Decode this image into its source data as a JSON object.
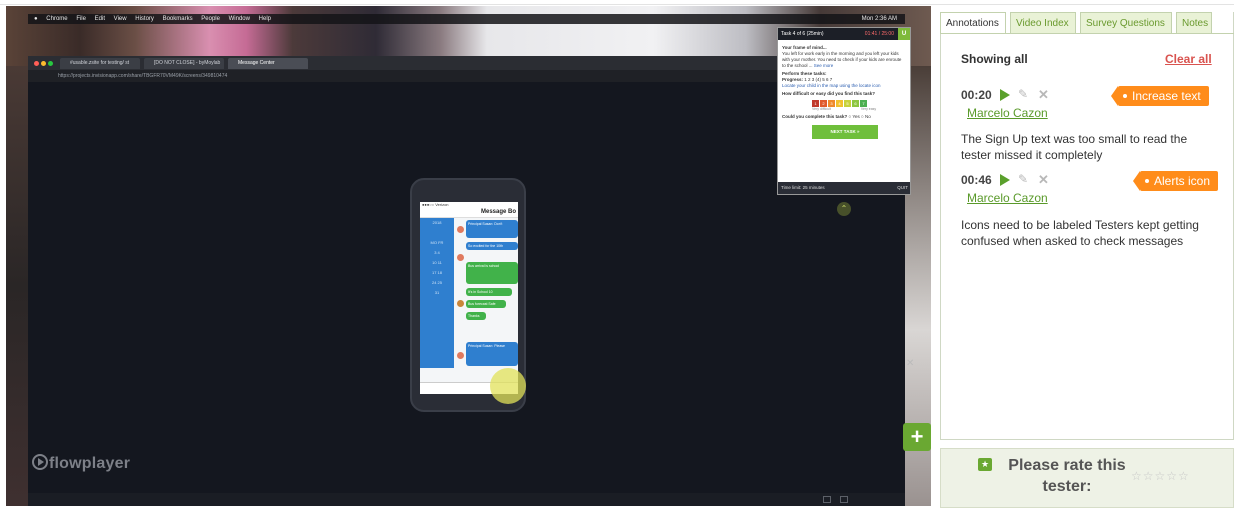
{
  "recording": {
    "menubar": {
      "items": [
        "Chrome",
        "File",
        "Edit",
        "View",
        "History",
        "Bookmarks",
        "People",
        "Window",
        "Help"
      ],
      "clock": "Mon 2:36 AM"
    },
    "browser_tabs": [
      {
        "label": "#usable.zsite for testing/ st"
      },
      {
        "label": "[DO NOT CLOSE] - byMoylab"
      },
      {
        "label": "Message Center"
      }
    ],
    "address": "https://projects.invisionapp.com/share/TBGFR70VM49K/screens/349810474",
    "phone": {
      "status": "●●●○○ Verizon",
      "title": "Message Bo",
      "calendar_rows": [
        "2018",
        "",
        "MO  FR",
        "3  4",
        "10  11",
        "17  18",
        "24  25",
        "31"
      ],
      "bubbles": [
        {
          "text": "Principal Susan: Don't",
          "color": "blue"
        },
        {
          "text": "So excited for the 10th",
          "color": "blue"
        },
        {
          "text": "Bus arrival is school",
          "color": "green"
        },
        {
          "text": "It's in School 10",
          "color": "green"
        },
        {
          "text": "Bus forecast Safe",
          "color": "green"
        },
        {
          "text": "Thanks",
          "color": "green"
        },
        {
          "text": "Principal Susan: Please",
          "color": "blue"
        }
      ]
    },
    "task": {
      "header": "Task 4 of 6 (25min)",
      "timer": "01:41 / 25:00",
      "frame_title": "Your frame of mind...",
      "frame_text": "You left for work early in the morning and you left your kids with your mother. You need to check if your kids are enroute to the school ...",
      "see_more": "See more",
      "perform_label": "Perform these tasks:",
      "progress_label": "Progress:",
      "progress_steps": "1 2 3 (4) 5 6 7",
      "task_instruction": "Locate your child in the map using the locate icon",
      "difficulty_question": "How difficult or easy did you find this task?",
      "scale": [
        "1",
        "2",
        "3",
        "4",
        "5",
        "6",
        "7"
      ],
      "scale_low": "Very difficult",
      "scale_high": "Very easy",
      "complete_question": "Could you complete this task?",
      "yes": "Yes",
      "no": "No",
      "next_task": "NEXT TASK »",
      "time_limit": "Time limit: 25 minutes",
      "quit": "QUIT"
    },
    "player_brand": "flowplayer"
  },
  "sidebar": {
    "tabs": [
      {
        "label": "Annotations",
        "active": true
      },
      {
        "label": "Video Index",
        "active": false
      },
      {
        "label": "Survey Questions",
        "active": false
      },
      {
        "label": "Notes",
        "active": false
      }
    ],
    "showing": "Showing all",
    "clear_all": "Clear all",
    "annotations": [
      {
        "time": "00:20",
        "tag": "Increase text",
        "author": "Marcelo Cazon",
        "text_lines": [
          "The Sign Up text was too small to read the",
          "tester missed it completely"
        ]
      },
      {
        "time": "00:46",
        "tag": "Alerts icon",
        "author": "Marcelo Cazon",
        "text_lines": [
          "Icons need to be labeled Testers kept getting",
          "confused when asked to check messages"
        ]
      }
    ],
    "rate": {
      "label_line1": "Please rate this",
      "label_line2": "tester:",
      "stars": "☆☆☆☆☆"
    }
  },
  "colors": {
    "accent_green": "#6aa832",
    "tag_orange": "#ff8c1a",
    "clear_red": "#d9534f",
    "link_green": "#5a9a2a"
  }
}
